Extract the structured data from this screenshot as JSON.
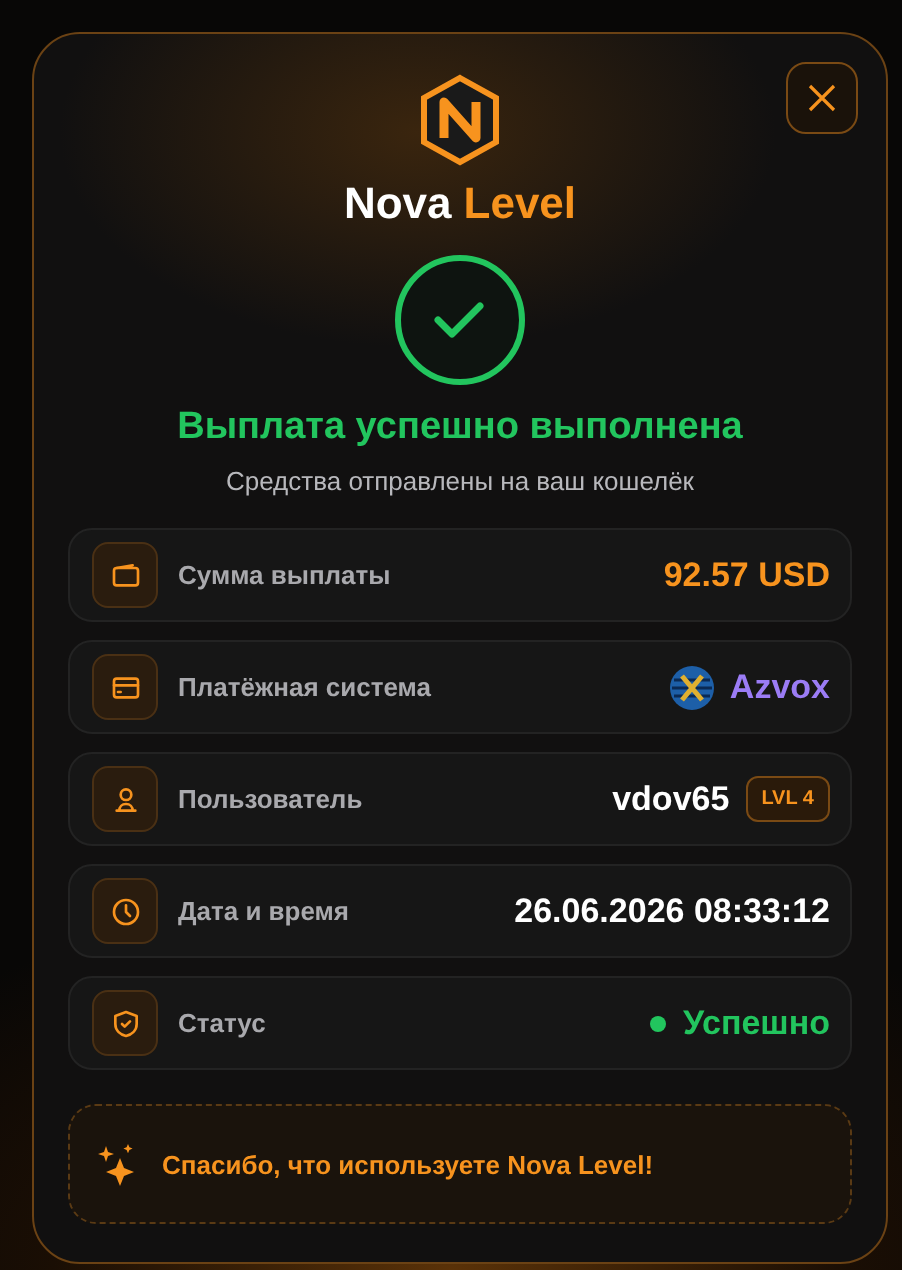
{
  "brand": {
    "name": "Nova",
    "accent": "Level"
  },
  "title": "Выплата успешно выполнена",
  "subtitle": "Средства отправлены на ваш кошелёк",
  "rows": [
    {
      "kind": "amount",
      "label": "Сумма выплаты",
      "value": "92.57 USD"
    },
    {
      "kind": "system",
      "label": "Платёжная система",
      "value": "Azvox"
    },
    {
      "kind": "user",
      "label": "Пользователь",
      "value": "vdov65",
      "badge": "LVL 4"
    },
    {
      "kind": "datetime",
      "label": "Дата и время",
      "value": "26.06.2026 08:33:12"
    },
    {
      "kind": "status",
      "label": "Статус",
      "value": "Успешно",
      "color": "#22c55e"
    }
  ],
  "footer": "Спасибо, что используете Nova Level!"
}
